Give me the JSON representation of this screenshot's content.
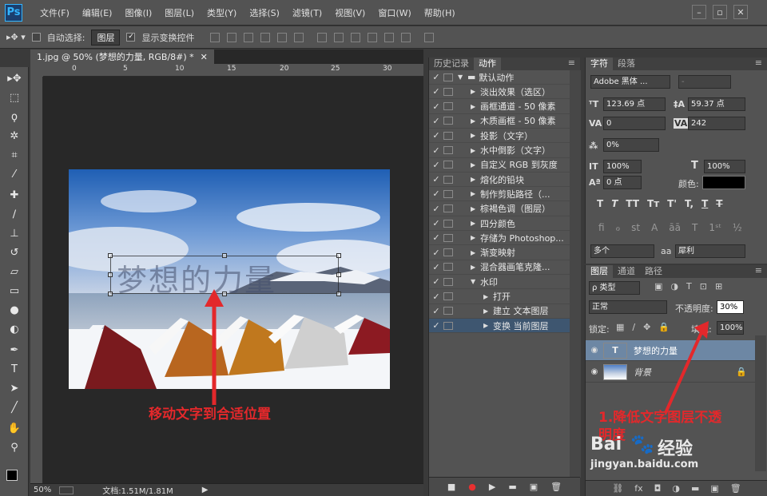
{
  "app": {
    "logo": "Ps"
  },
  "menu": [
    "文件(F)",
    "编辑(E)",
    "图像(I)",
    "图层(L)",
    "类型(Y)",
    "选择(S)",
    "滤镜(T)",
    "视图(V)",
    "窗口(W)",
    "帮助(H)"
  ],
  "options": {
    "auto_select_label": "自动选择:",
    "auto_select_value": "图层",
    "show_transform_label": "显示变换控件"
  },
  "document": {
    "tab_title": "1.jpg @ 50% (梦想的力量, RGB/8#) *",
    "ruler_marks": [
      "0",
      "5",
      "10",
      "15",
      "20",
      "25",
      "30"
    ],
    "zoom": "50%",
    "doc_size": "文档:1.51M/1.81M",
    "watermark_text": "梦想的力量",
    "annotation_move": "移动文字到合适位置"
  },
  "actions_panel": {
    "tabs": [
      "历史记录",
      "动作"
    ],
    "rows": [
      {
        "label": "默认动作",
        "indent": 0,
        "folder": true,
        "expanded": true
      },
      {
        "label": "淡出效果（选区）",
        "indent": 1
      },
      {
        "label": "画框通道 - 50 像素",
        "indent": 1
      },
      {
        "label": "木质画框 - 50 像素",
        "indent": 1
      },
      {
        "label": "投影（文字）",
        "indent": 1
      },
      {
        "label": "水中倒影（文字）",
        "indent": 1
      },
      {
        "label": "自定义 RGB 到灰度",
        "indent": 1
      },
      {
        "label": "熔化的铅块",
        "indent": 1
      },
      {
        "label": "制作剪贴路径（...",
        "indent": 1
      },
      {
        "label": "棕褐色调（图层）",
        "indent": 1
      },
      {
        "label": "四分颜色",
        "indent": 1
      },
      {
        "label": "存储为 Photoshop...",
        "indent": 1
      },
      {
        "label": "渐变映射",
        "indent": 1
      },
      {
        "label": "混合器画笔克隆...",
        "indent": 1
      },
      {
        "label": "水印",
        "indent": 1,
        "expanded": true
      },
      {
        "label": "打开",
        "indent": 2
      },
      {
        "label": "建立 文本图层",
        "indent": 2
      },
      {
        "label": "变换 当前图层",
        "indent": 2,
        "selected": true
      }
    ]
  },
  "character_panel": {
    "tabs": [
      "字符",
      "段落"
    ],
    "font_family": "Adobe 黑体 ...",
    "font_style": "-",
    "font_size": "123.69 点",
    "leading": "59.37 点",
    "kerning": "0",
    "tracking": "242",
    "scale_percent": "0%",
    "vertical_scale": "100%",
    "horizontal_scale": "100%",
    "baseline": "0 点",
    "color_label": "颜色:",
    "type_style_buttons": [
      "T",
      "T",
      "TT",
      "Tт",
      "T'",
      "T,",
      "T",
      "T"
    ],
    "language": "多个",
    "antialias_label": "aa",
    "antialias": "犀利"
  },
  "layers_panel": {
    "tabs": [
      "图层",
      "通道",
      "路径"
    ],
    "filter_kind": "ρ 类型",
    "blend_mode": "正常",
    "opacity_label": "不透明度:",
    "opacity": "30%",
    "lock_label": "锁定:",
    "fill_label": "填充:",
    "fill": "100%",
    "layers": [
      {
        "name": "梦想的力量",
        "type": "text",
        "selected": true
      },
      {
        "name": "背景",
        "type": "image",
        "locked": true
      }
    ],
    "annotation_line1": "1.降低文字图层不透",
    "annotation_line2": "明度"
  },
  "site_watermark": {
    "brand_left": "Bai",
    "brand_right": "经验",
    "url": "jingyan.baidu.com"
  },
  "colors": {
    "annotation_red": "#e3282b",
    "panel_bg": "#535353",
    "selected_row": "#3e5670",
    "ps_blue": "#33b6ff"
  }
}
